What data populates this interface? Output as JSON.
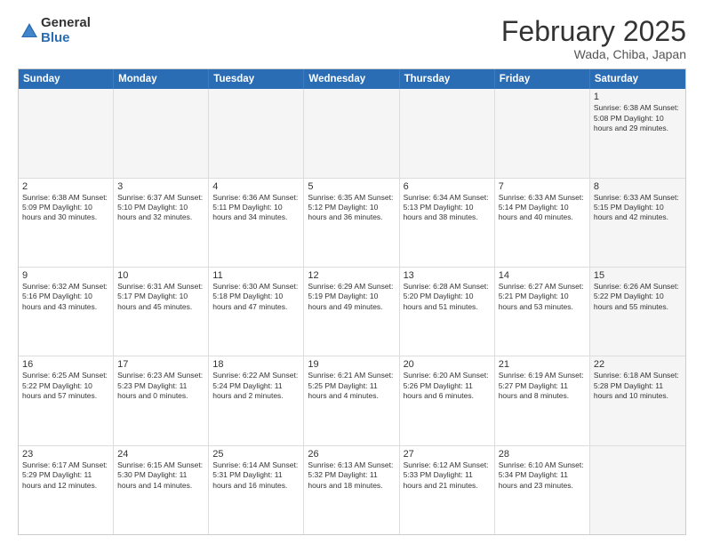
{
  "logo": {
    "general": "General",
    "blue": "Blue"
  },
  "title": "February 2025",
  "location": "Wada, Chiba, Japan",
  "days": [
    "Sunday",
    "Monday",
    "Tuesday",
    "Wednesday",
    "Thursday",
    "Friday",
    "Saturday"
  ],
  "weeks": [
    [
      {
        "day": "",
        "info": "",
        "empty": true
      },
      {
        "day": "",
        "info": "",
        "empty": true
      },
      {
        "day": "",
        "info": "",
        "empty": true
      },
      {
        "day": "",
        "info": "",
        "empty": true
      },
      {
        "day": "",
        "info": "",
        "empty": true
      },
      {
        "day": "",
        "info": "",
        "empty": true
      },
      {
        "day": "1",
        "info": "Sunrise: 6:38 AM\nSunset: 5:08 PM\nDaylight: 10 hours and 29 minutes.",
        "shade": true
      }
    ],
    [
      {
        "day": "2",
        "info": "Sunrise: 6:38 AM\nSunset: 5:09 PM\nDaylight: 10 hours and 30 minutes.",
        "shade": false
      },
      {
        "day": "3",
        "info": "Sunrise: 6:37 AM\nSunset: 5:10 PM\nDaylight: 10 hours and 32 minutes.",
        "shade": false
      },
      {
        "day": "4",
        "info": "Sunrise: 6:36 AM\nSunset: 5:11 PM\nDaylight: 10 hours and 34 minutes.",
        "shade": false
      },
      {
        "day": "5",
        "info": "Sunrise: 6:35 AM\nSunset: 5:12 PM\nDaylight: 10 hours and 36 minutes.",
        "shade": false
      },
      {
        "day": "6",
        "info": "Sunrise: 6:34 AM\nSunset: 5:13 PM\nDaylight: 10 hours and 38 minutes.",
        "shade": false
      },
      {
        "day": "7",
        "info": "Sunrise: 6:33 AM\nSunset: 5:14 PM\nDaylight: 10 hours and 40 minutes.",
        "shade": false
      },
      {
        "day": "8",
        "info": "Sunrise: 6:33 AM\nSunset: 5:15 PM\nDaylight: 10 hours and 42 minutes.",
        "shade": true
      }
    ],
    [
      {
        "day": "9",
        "info": "Sunrise: 6:32 AM\nSunset: 5:16 PM\nDaylight: 10 hours and 43 minutes.",
        "shade": false
      },
      {
        "day": "10",
        "info": "Sunrise: 6:31 AM\nSunset: 5:17 PM\nDaylight: 10 hours and 45 minutes.",
        "shade": false
      },
      {
        "day": "11",
        "info": "Sunrise: 6:30 AM\nSunset: 5:18 PM\nDaylight: 10 hours and 47 minutes.",
        "shade": false
      },
      {
        "day": "12",
        "info": "Sunrise: 6:29 AM\nSunset: 5:19 PM\nDaylight: 10 hours and 49 minutes.",
        "shade": false
      },
      {
        "day": "13",
        "info": "Sunrise: 6:28 AM\nSunset: 5:20 PM\nDaylight: 10 hours and 51 minutes.",
        "shade": false
      },
      {
        "day": "14",
        "info": "Sunrise: 6:27 AM\nSunset: 5:21 PM\nDaylight: 10 hours and 53 minutes.",
        "shade": false
      },
      {
        "day": "15",
        "info": "Sunrise: 6:26 AM\nSunset: 5:22 PM\nDaylight: 10 hours and 55 minutes.",
        "shade": true
      }
    ],
    [
      {
        "day": "16",
        "info": "Sunrise: 6:25 AM\nSunset: 5:22 PM\nDaylight: 10 hours and 57 minutes.",
        "shade": false
      },
      {
        "day": "17",
        "info": "Sunrise: 6:23 AM\nSunset: 5:23 PM\nDaylight: 11 hours and 0 minutes.",
        "shade": false
      },
      {
        "day": "18",
        "info": "Sunrise: 6:22 AM\nSunset: 5:24 PM\nDaylight: 11 hours and 2 minutes.",
        "shade": false
      },
      {
        "day": "19",
        "info": "Sunrise: 6:21 AM\nSunset: 5:25 PM\nDaylight: 11 hours and 4 minutes.",
        "shade": false
      },
      {
        "day": "20",
        "info": "Sunrise: 6:20 AM\nSunset: 5:26 PM\nDaylight: 11 hours and 6 minutes.",
        "shade": false
      },
      {
        "day": "21",
        "info": "Sunrise: 6:19 AM\nSunset: 5:27 PM\nDaylight: 11 hours and 8 minutes.",
        "shade": false
      },
      {
        "day": "22",
        "info": "Sunrise: 6:18 AM\nSunset: 5:28 PM\nDaylight: 11 hours and 10 minutes.",
        "shade": true
      }
    ],
    [
      {
        "day": "23",
        "info": "Sunrise: 6:17 AM\nSunset: 5:29 PM\nDaylight: 11 hours and 12 minutes.",
        "shade": false
      },
      {
        "day": "24",
        "info": "Sunrise: 6:15 AM\nSunset: 5:30 PM\nDaylight: 11 hours and 14 minutes.",
        "shade": false
      },
      {
        "day": "25",
        "info": "Sunrise: 6:14 AM\nSunset: 5:31 PM\nDaylight: 11 hours and 16 minutes.",
        "shade": false
      },
      {
        "day": "26",
        "info": "Sunrise: 6:13 AM\nSunset: 5:32 PM\nDaylight: 11 hours and 18 minutes.",
        "shade": false
      },
      {
        "day": "27",
        "info": "Sunrise: 6:12 AM\nSunset: 5:33 PM\nDaylight: 11 hours and 21 minutes.",
        "shade": false
      },
      {
        "day": "28",
        "info": "Sunrise: 6:10 AM\nSunset: 5:34 PM\nDaylight: 11 hours and 23 minutes.",
        "shade": false
      },
      {
        "day": "",
        "info": "",
        "empty": true,
        "shade": true
      }
    ]
  ]
}
